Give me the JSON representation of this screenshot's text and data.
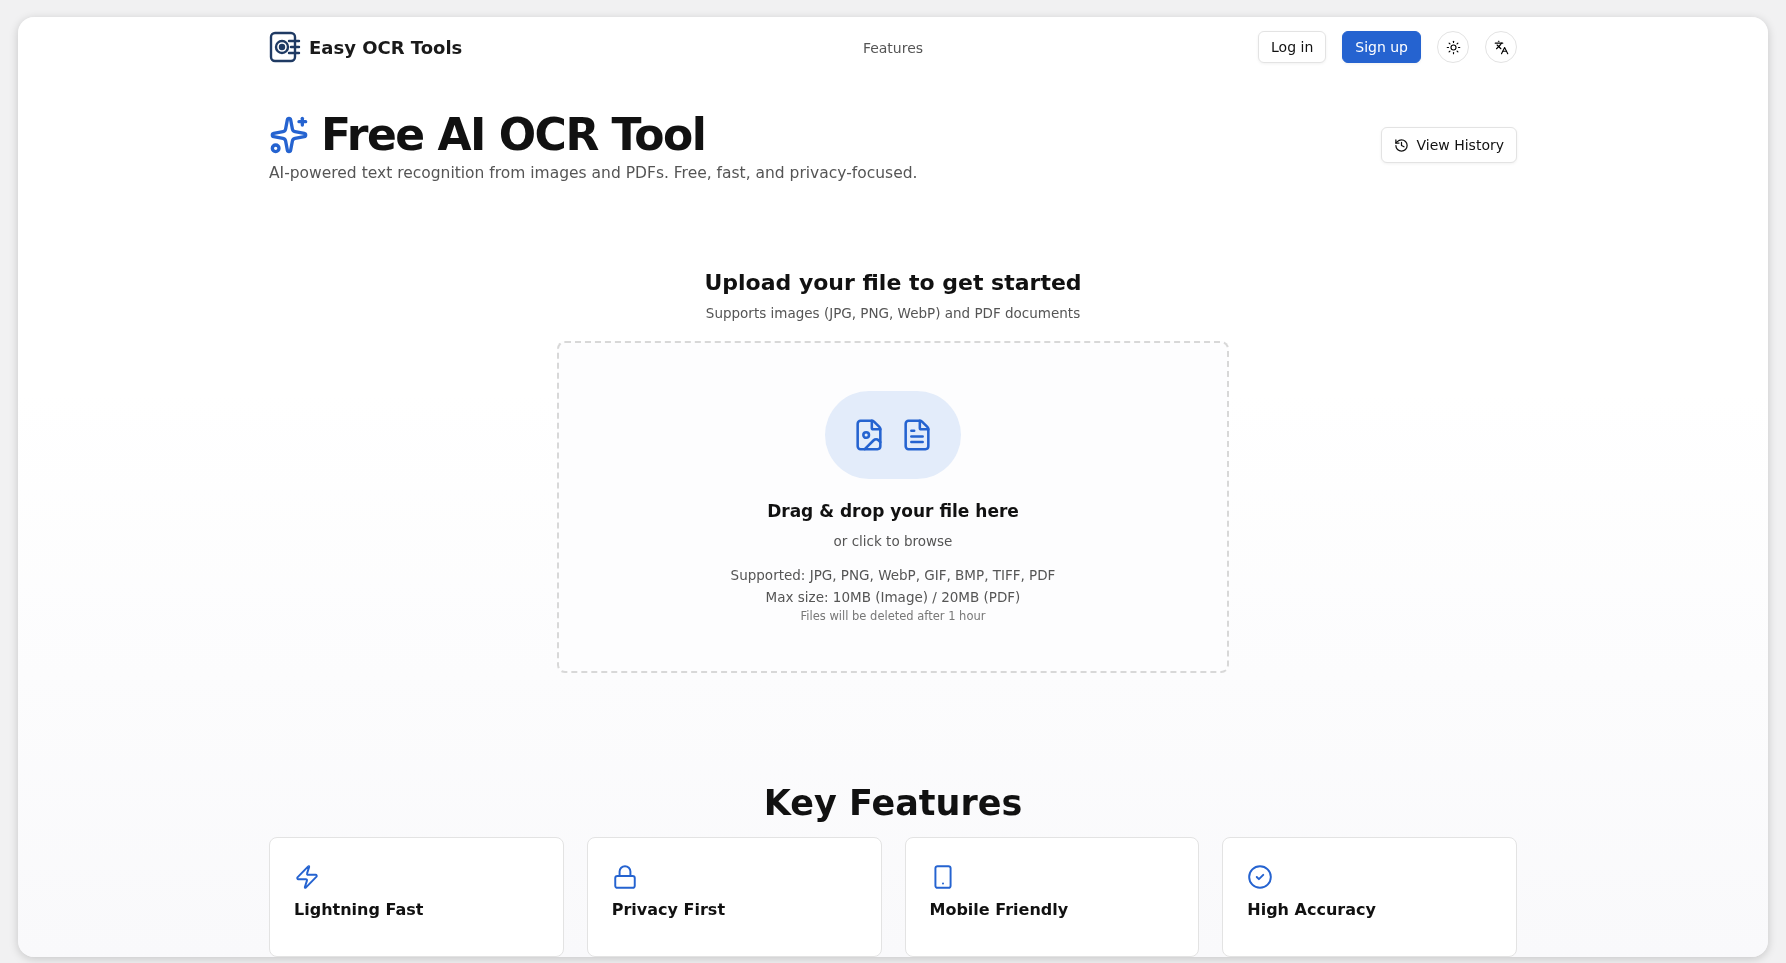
{
  "brand": {
    "name": "Easy OCR Tools"
  },
  "nav": [
    {
      "label": "Features"
    }
  ],
  "auth": {
    "login": "Log in",
    "signup": "Sign up"
  },
  "hero": {
    "title": "Free AI OCR Tool",
    "subtitle": "AI-powered text recognition from images and PDFs. Free, fast, and privacy-focused.",
    "history_button": "View History"
  },
  "upload": {
    "heading": "Upload your file to get started",
    "subheading": "Supports images (JPG, PNG, WebP) and PDF documents",
    "dropzone": {
      "title": "Drag & drop your file here",
      "browse": "or click to browse",
      "supported": "Supported: JPG, PNG, WebP, GIF, BMP, TIFF, PDF",
      "max_size": "Max size: 10MB (Image) / 20MB (PDF)",
      "retention": "Files will be deleted after 1 hour"
    }
  },
  "features": {
    "heading": "Key Features",
    "cards": [
      {
        "kind": "speed",
        "title": "Lightning Fast"
      },
      {
        "kind": "privacy",
        "title": "Privacy First"
      },
      {
        "kind": "mobile",
        "title": "Mobile Friendly"
      },
      {
        "kind": "accuracy",
        "title": "High Accuracy"
      }
    ]
  }
}
